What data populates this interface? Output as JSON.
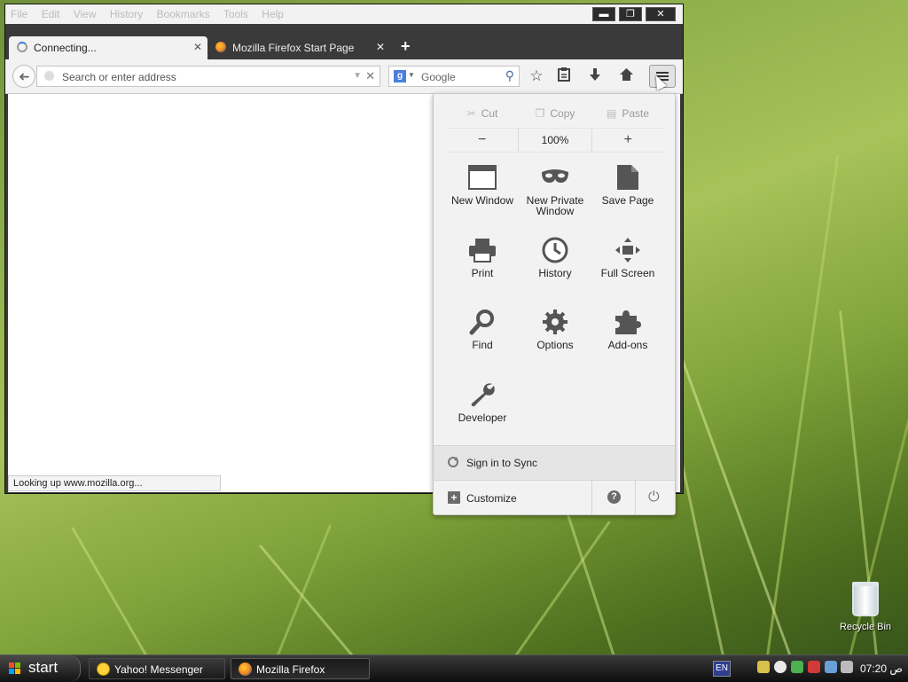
{
  "window": {
    "menubar": [
      "File",
      "Edit",
      "View",
      "History",
      "Bookmarks",
      "Tools",
      "Help"
    ],
    "controls": {
      "minimize": "▬",
      "maximize": "❐",
      "close": "✕"
    }
  },
  "tabs": [
    {
      "label": "Connecting...",
      "close": "✕",
      "state": "loading"
    },
    {
      "label": "Mozilla Firefox Start Page",
      "close": "✕",
      "icon": "firefox-icon"
    }
  ],
  "new_tab_symbol": "+",
  "navbar": {
    "back_symbol": "➜",
    "url_placeholder": "Search or enter address",
    "url_value": "",
    "search_engine_letter": "g",
    "search_placeholder": "Google",
    "icons": [
      "bookmark-star-icon",
      "bookmarks-list-icon",
      "downloads-icon",
      "home-icon",
      "menu-icon"
    ]
  },
  "status_text": "Looking up www.mozilla.org...",
  "menu_panel": {
    "edit": {
      "cut": "Cut",
      "copy": "Copy",
      "paste": "Paste"
    },
    "zoom": {
      "minus": "−",
      "level": "100%",
      "plus": "+"
    },
    "items": [
      {
        "label": "New Window",
        "icon": "new-window-icon"
      },
      {
        "label": "New Private Window",
        "icon": "private-mask-icon"
      },
      {
        "label": "Save Page",
        "icon": "save-page-icon"
      },
      {
        "label": "Print",
        "icon": "printer-icon"
      },
      {
        "label": "History",
        "icon": "clock-icon"
      },
      {
        "label": "Full Screen",
        "icon": "fullscreen-icon"
      },
      {
        "label": "Find",
        "icon": "magnifier-icon"
      },
      {
        "label": "Options",
        "icon": "gear-icon"
      },
      {
        "label": "Add-ons",
        "icon": "puzzle-icon"
      },
      {
        "label": "Developer",
        "icon": "wrench-icon"
      }
    ],
    "sync": "Sign in to Sync",
    "customize": "Customize",
    "help": "?",
    "quit": "⏻"
  },
  "desktop": {
    "recycle_bin": "Recycle Bin"
  },
  "taskbar": {
    "start": "start",
    "buttons": [
      {
        "label": "Yahoo! Messenger",
        "icon": "yahoo-messenger-icon"
      },
      {
        "label": "Mozilla Firefox",
        "icon": "firefox-icon",
        "active": true
      }
    ],
    "language": "EN",
    "clock": "07:20 ص"
  },
  "colors": {
    "accent_blue": "#3b7ddd",
    "panel_bg": "#f2f2f2",
    "taskbar": "#1b1b1b"
  }
}
